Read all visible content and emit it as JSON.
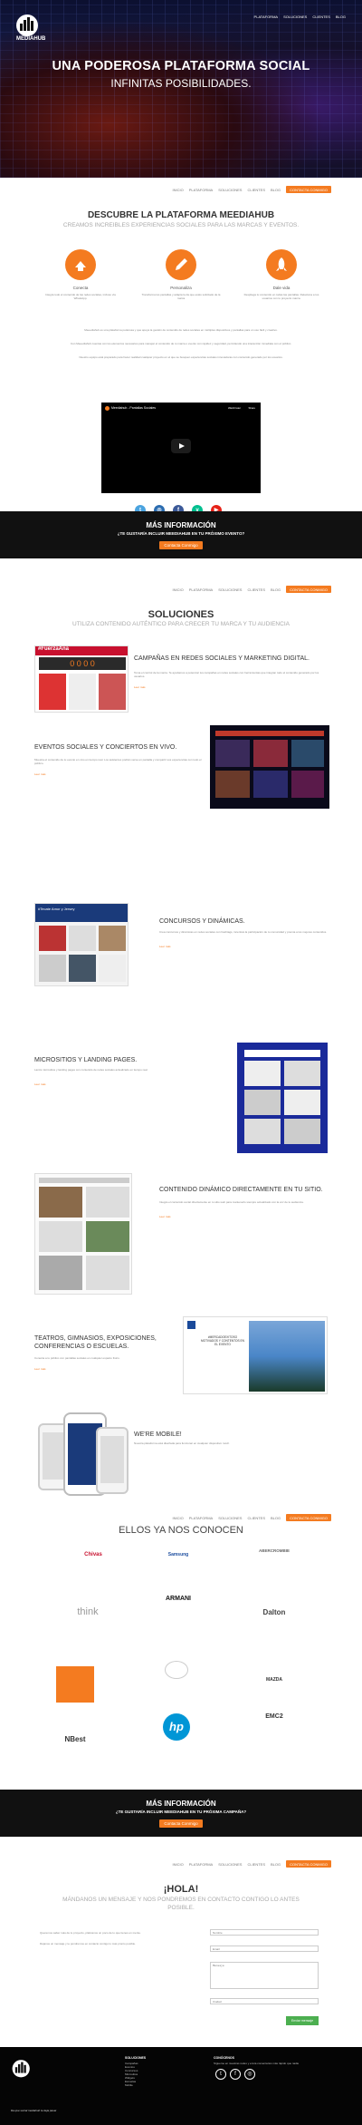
{
  "brand": {
    "name": "MEDIAHUB",
    "orange": "#f47b20"
  },
  "topnav": [
    "PLATAFORMA",
    "SOLUCIONES",
    "CLIENTES",
    "BLOG"
  ],
  "subnav": {
    "items": [
      "INICIO",
      "PLATAFORMA",
      "SOLUCIONES",
      "CLIENTES",
      "BLOG"
    ],
    "cta": "Contacta Conmigo"
  },
  "hero": {
    "title": "UNA PODEROSA PLATAFORMA SOCIAL",
    "subtitle": "INFINITAS POSIBILIDADES."
  },
  "discover": {
    "title": "DESCUBRE LA PLATAFORMA MEEDIAHUB",
    "subtitle": "CREAMOS INCREIBLES EXPERIENCIAS SOCIALES PARA LAS MARCAS Y EVENTOS.",
    "features": [
      {
        "name": "Conecta",
        "text": "Integra todo el contenido de las redes sociales, incluso vía WhatsApp.",
        "icon": "hand-icon"
      },
      {
        "name": "Personaliza",
        "text": "Transforma los pantallas y adapta la da que estés solicitado de la marca",
        "icon": "pencil-icon"
      },
      {
        "name": "Dale vida",
        "text": "Despliega tu contenido en todas las pantallas. Relaciona a tus usuarios con tu proyecto marca.",
        "icon": "rocket-icon"
      }
    ],
    "paras": [
      "Meeediahub es una plataforma poderosa y que apoya la gestión de contenido de redes sociales en múltiples dispositivos y pantallas para un uso fácil y creativo.",
      "Con Meeediahub cuentas con los elementos necesarios para manejar el contenido de tu marca o evento con rapidez y seguridad, permitiendo una interacción inmediata con el público.",
      "Nuestro equipo está preparado para hacer realidad cualquier proyecto en el que se busquen experiencias sociales innovadoras con contenido generado por los usuarios."
    ],
    "video_title": "Meediahub - Pantallas Sociales",
    "video_actions": [
      "Watch later",
      "Share"
    ]
  },
  "social_icons": [
    {
      "name": "twitter",
      "color": "#4aa3df",
      "glyph": "t"
    },
    {
      "name": "instagram",
      "color": "#2b6cb0",
      "glyph": "◎"
    },
    {
      "name": "facebook",
      "color": "#3b5998",
      "glyph": "f"
    },
    {
      "name": "vine",
      "color": "#00bf8f",
      "glyph": "v"
    },
    {
      "name": "youtube",
      "color": "#e62117",
      "glyph": "▶"
    }
  ],
  "info1": {
    "title": "MÁS INFORMACIÓN",
    "subtitle": "¿TE GUSTARÍA INCLUIR MEEDIAHUB EN TU PRÓXIMO EVENTO?",
    "button": "Contacta Conmigo"
  },
  "solutions": {
    "title": "SOLUCIONES",
    "subtitle": "UTILIZA CONTENIDO AUTÉNTICO PARA CRECER TU MARCA Y TU AUDIENCIA",
    "more": "Leer más",
    "items": [
      {
        "title": "CAMPAÑAS EN REDES SOCIALES Y MARKETING DIGITAL.",
        "text": "Toma el control de la marca. Te ayudamos a potenciar tus campañas en redes sociales con herramientas que integran todo el contenido generado por los usuarios."
      },
      {
        "title": "EVENTOS SOCIALES Y CONCIERTOS EN VIVO.",
        "text": "Muestra el contenido de tu evento en vivo en tiempo real. Los asistentes podrán verse en pantalla y compartir sus experiencias con todo el público."
      },
      {
        "title": "CONCURSOS Y DINÁMICAS.",
        "text": "Crea concursos y dinámicas en redes sociales con hashtags, incentiva la participación de tu comunidad y premia a los mejores contenidos."
      },
      {
        "title": "MICROSITIOS Y LANDING PAGES.",
        "text": "Lanza micrositios y landing pages con contenido de redes sociales actualizado en tiempo real."
      },
      {
        "title": "CONTENIDO DINÁMICO DIRECTAMENTE EN TU SITIO.",
        "text": "Integra el contenido social directamente en tu sitio web para mantenerlo siempre actualizado con la voz de tu audiencia."
      },
      {
        "title": "TEATROS, GIMNASIOS, EXPOSICIONES, CONFERENCIAS O ESCUELAS.",
        "text": "Conecta a tu público con pantallas sociales en cualquier espacio físico."
      },
      {
        "title": "WE'RE MOBILE!",
        "text": "Nuestra plataforma está diseñada para funcionar en cualquier dispositivo móvil."
      }
    ],
    "shot1_text": "#FuerzaAna",
    "shot1_counter": "0 0 0 0",
    "shot3_text": "#Tecate Amor y Jersey",
    "shot6_text": "#MERCADOEXITOSO MOTIVADOS Y CONTENTOS EN EL EVENTO"
  },
  "clients": {
    "title": "ELLOS YA NOS CONOCEN",
    "logos": [
      {
        "name": "Chivas",
        "text": "Chivas",
        "color": "#c8102e"
      },
      {
        "name": "Samsung",
        "text": "Samsung",
        "color": "#1f4fa0"
      },
      {
        "name": "Abercrombie",
        "text": "ABERCROMBIE",
        "color": "#666"
      },
      {
        "name": "Think",
        "text": "think",
        "color": "#999"
      },
      {
        "name": "Armani",
        "text": "ARMANI",
        "color": "#111"
      },
      {
        "name": "Dalton",
        "text": "Dalton",
        "color": "#444"
      },
      {
        "name": "Orange",
        "text": "",
        "color": "#f47b20"
      },
      {
        "name": "Cream",
        "text": "",
        "color": "#aaa"
      },
      {
        "name": "Mazda",
        "text": "MAZDA",
        "color": "#333"
      },
      {
        "name": "Best",
        "text": "NBest",
        "color": "#333"
      },
      {
        "name": "HP",
        "text": "hp",
        "color": "#0096d6"
      },
      {
        "name": "EMC",
        "text": "EMC2",
        "color": "#333"
      }
    ]
  },
  "info2": {
    "title": "MÁS INFORMACIÓN",
    "subtitle": "¿TE GUSTARÍA INCLUIR MEEDIAHUB EN TU PRÓXIMA CAMPAÑA?",
    "button": "Contacta Conmigo"
  },
  "contact": {
    "title": "¡HOLA!",
    "subtitle": "MÁNDANOS UN MENSAJE Y NOS PONDREMOS EN CONTACTO CONTIGO LO ANTES POSIBLE.",
    "text1": "Queremos saber más de tu proyecto, platícanos un poco de lo que tienes en mente.",
    "text2": "Déjanos un mensaje y te pondremos en contacto contigo lo más pronto posible.",
    "fields": [
      "Nombre",
      "Email",
      "Mensaje",
      "Ciudad"
    ],
    "send": "Enviar mensaje"
  },
  "footer": {
    "tagline": "Da que social mediahub te deja pasar",
    "col1_title": "SOLUCIONES",
    "col1": [
      "Campañas",
      "Eventos",
      "Concursos",
      "Micrositios",
      "Widgets",
      "Escuelas",
      "Mobile"
    ],
    "col2_title": "CONÓCENOS",
    "col2_text": "Sígueme en nuestras redes y envía comentarios más rápido que nadie"
  }
}
